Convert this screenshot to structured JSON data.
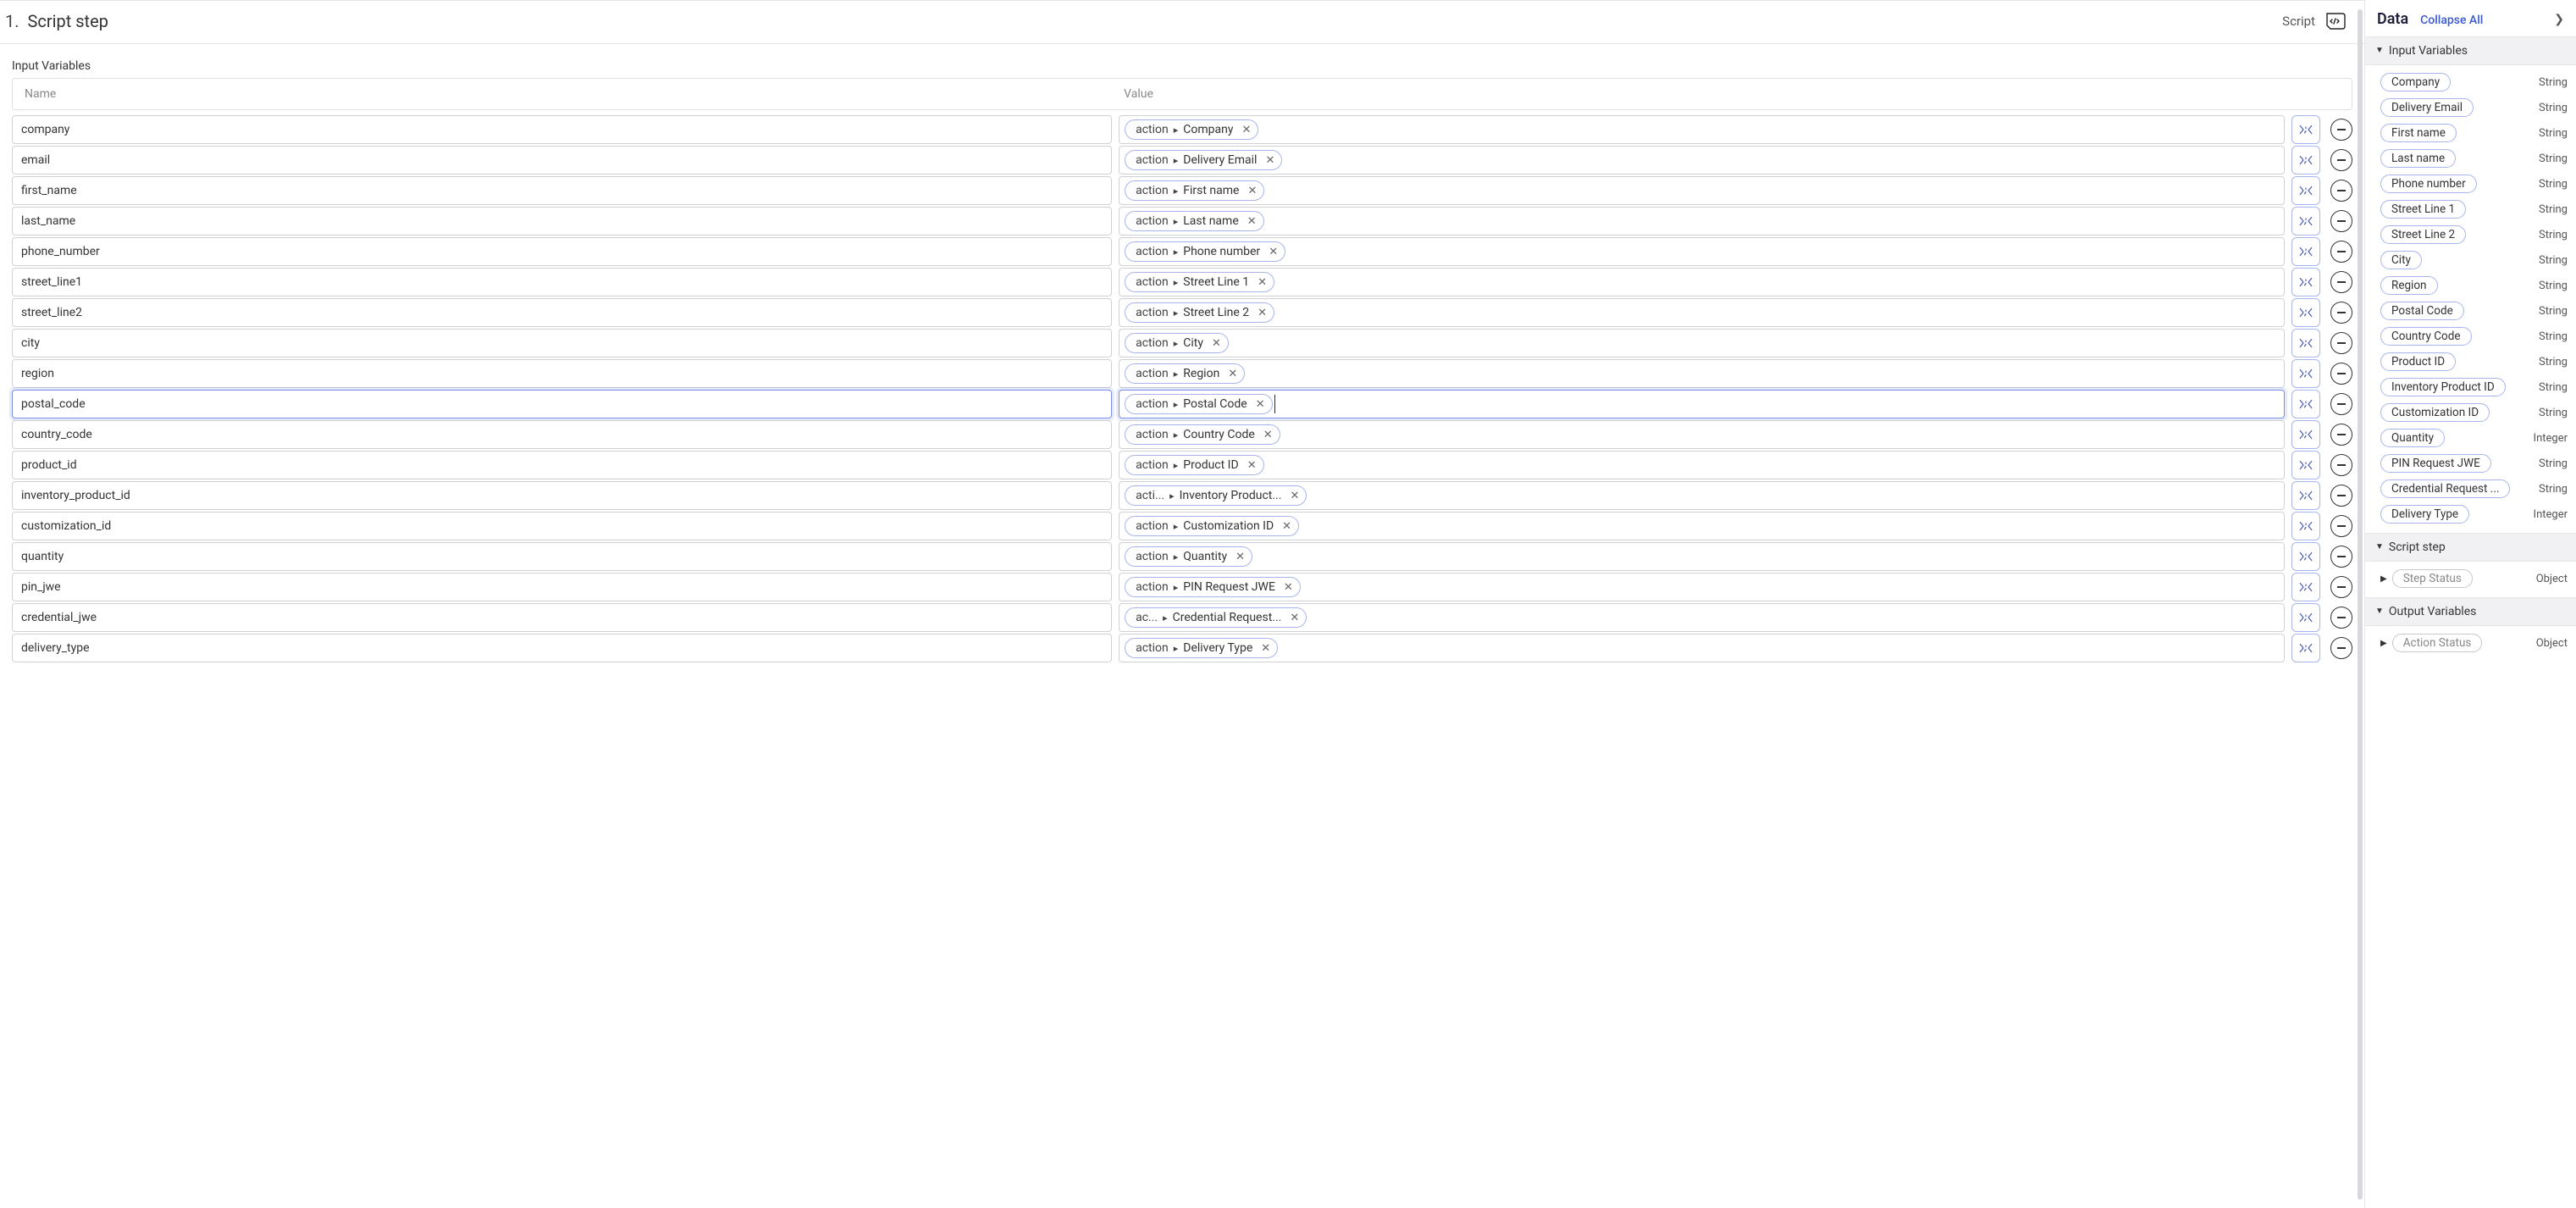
{
  "header": {
    "step_number": "1.",
    "title": "Script step",
    "script_label": "Script"
  },
  "table": {
    "section_label": "Input Variables",
    "name_header": "Name",
    "value_header": "Value",
    "rows": [
      {
        "name": "company",
        "value_pre": "action",
        "value_post": "Company",
        "selected": false
      },
      {
        "name": "email",
        "value_pre": "action",
        "value_post": "Delivery Email",
        "selected": false
      },
      {
        "name": "first_name",
        "value_pre": "action",
        "value_post": "First name",
        "selected": false
      },
      {
        "name": "last_name",
        "value_pre": "action",
        "value_post": "Last name",
        "selected": false
      },
      {
        "name": "phone_number",
        "value_pre": "action",
        "value_post": "Phone number",
        "selected": false
      },
      {
        "name": "street_line1",
        "value_pre": "action",
        "value_post": "Street Line 1",
        "selected": false
      },
      {
        "name": "street_line2",
        "value_pre": "action",
        "value_post": "Street Line 2",
        "selected": false
      },
      {
        "name": "city",
        "value_pre": "action",
        "value_post": "City",
        "selected": false
      },
      {
        "name": "region",
        "value_pre": "action",
        "value_post": "Region",
        "selected": false
      },
      {
        "name": "postal_code",
        "value_pre": "action",
        "value_post": "Postal Code",
        "selected": true
      },
      {
        "name": "country_code",
        "value_pre": "action",
        "value_post": "Country Code",
        "selected": false
      },
      {
        "name": "product_id",
        "value_pre": "action",
        "value_post": "Product ID",
        "selected": false
      },
      {
        "name": "inventory_product_id",
        "value_pre": "acti...",
        "value_post": "Inventory Product...",
        "selected": false
      },
      {
        "name": "customization_id",
        "value_pre": "action",
        "value_post": "Customization ID",
        "selected": false
      },
      {
        "name": "quantity",
        "value_pre": "action",
        "value_post": "Quantity",
        "selected": false
      },
      {
        "name": "pin_jwe",
        "value_pre": "action",
        "value_post": "PIN Request JWE",
        "selected": false
      },
      {
        "name": "credential_jwe",
        "value_pre": "ac...",
        "value_post": "Credential Request...",
        "selected": false
      },
      {
        "name": "delivery_type",
        "value_pre": "action",
        "value_post": "Delivery Type",
        "selected": false
      }
    ]
  },
  "side": {
    "title": "Data",
    "collapse_label": "Collapse All",
    "groups": [
      {
        "title": "Input Variables",
        "items": [
          {
            "label": "Company",
            "type": "String",
            "gray": false,
            "arrow": false
          },
          {
            "label": "Delivery Email",
            "type": "String",
            "gray": false,
            "arrow": false
          },
          {
            "label": "First name",
            "type": "String",
            "gray": false,
            "arrow": false
          },
          {
            "label": "Last name",
            "type": "String",
            "gray": false,
            "arrow": false
          },
          {
            "label": "Phone number",
            "type": "String",
            "gray": false,
            "arrow": false
          },
          {
            "label": "Street Line 1",
            "type": "String",
            "gray": false,
            "arrow": false
          },
          {
            "label": "Street Line 2",
            "type": "String",
            "gray": false,
            "arrow": false
          },
          {
            "label": "City",
            "type": "String",
            "gray": false,
            "arrow": false
          },
          {
            "label": "Region",
            "type": "String",
            "gray": false,
            "arrow": false
          },
          {
            "label": "Postal Code",
            "type": "String",
            "gray": false,
            "arrow": false
          },
          {
            "label": "Country Code",
            "type": "String",
            "gray": false,
            "arrow": false
          },
          {
            "label": "Product ID",
            "type": "String",
            "gray": false,
            "arrow": false
          },
          {
            "label": "Inventory Product ID",
            "type": "String",
            "gray": false,
            "arrow": false
          },
          {
            "label": "Customization ID",
            "type": "String",
            "gray": false,
            "arrow": false
          },
          {
            "label": "Quantity",
            "type": "Integer",
            "gray": false,
            "arrow": false
          },
          {
            "label": "PIN Request JWE",
            "type": "String",
            "gray": false,
            "arrow": false
          },
          {
            "label": "Credential Request ...",
            "type": "String",
            "gray": false,
            "arrow": false
          },
          {
            "label": "Delivery Type",
            "type": "Integer",
            "gray": false,
            "arrow": false
          }
        ]
      },
      {
        "title": "Script step",
        "items": [
          {
            "label": "Step Status",
            "type": "Object",
            "gray": true,
            "arrow": true
          }
        ]
      },
      {
        "title": "Output Variables",
        "items": [
          {
            "label": "Action Status",
            "type": "Object",
            "gray": true,
            "arrow": true
          }
        ]
      }
    ]
  }
}
